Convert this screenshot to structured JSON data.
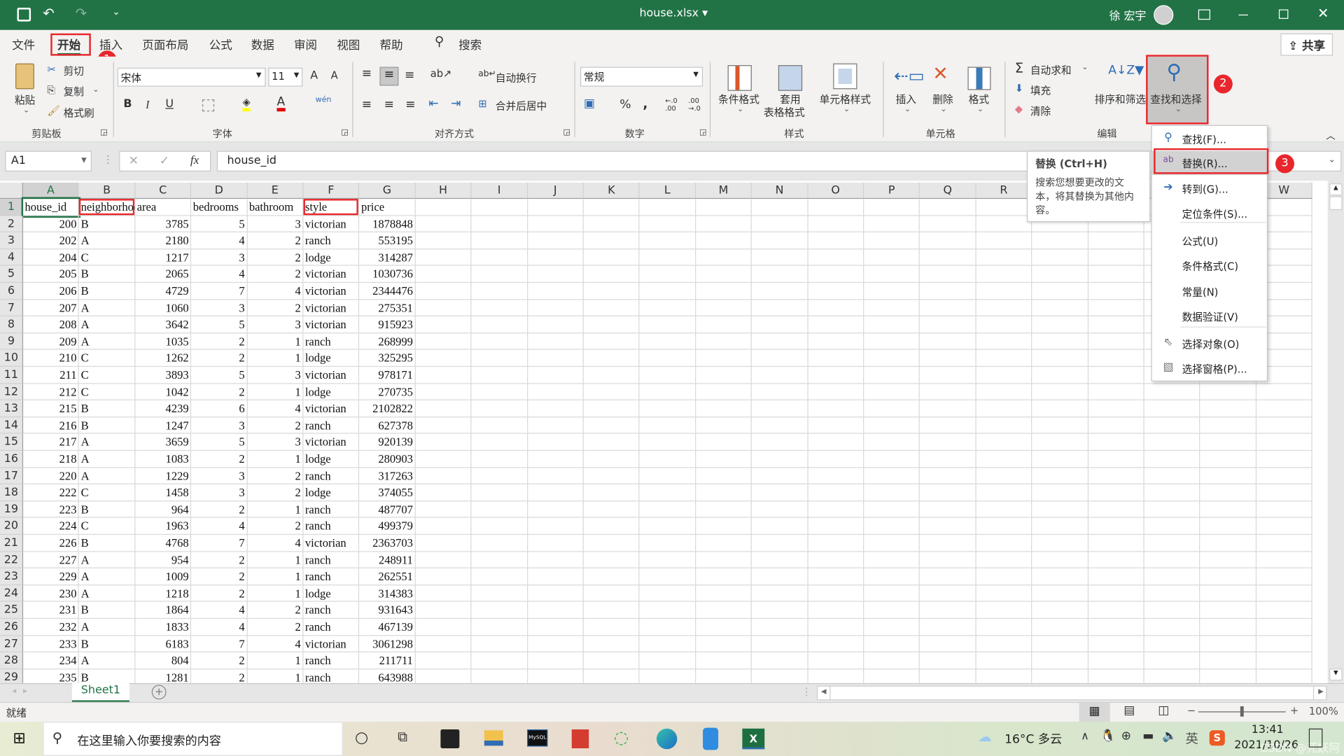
{
  "titlebar": {
    "filename": "house.xlsx",
    "dropdown": "▾",
    "user": "徐 宏宇",
    "qat_more": "⌄"
  },
  "tabs": [
    "文件",
    "开始",
    "插入",
    "页面布局",
    "公式",
    "数据",
    "审阅",
    "视图",
    "帮助"
  ],
  "active_tab": "开始",
  "search_label": "搜索",
  "share_label": "共享",
  "ribbon": {
    "clipboard": {
      "label": "剪贴板",
      "paste": "粘贴",
      "cut": "剪切",
      "copy": "复制",
      "format_painter": "格式刷"
    },
    "font": {
      "label": "字体",
      "name": "宋体",
      "size": "11",
      "bold": "B",
      "italic": "I",
      "underline": "U",
      "font_color": "A",
      "phonetic": "wén",
      "grow": "A",
      "shrink": "A"
    },
    "alignment": {
      "label": "对齐方式",
      "wrap": "自动换行",
      "merge": "合并后居中"
    },
    "number": {
      "label": "数字",
      "format": "常规",
      "percent": "%",
      "comma": ","
    },
    "styles": {
      "label": "样式",
      "conditional": "条件格式",
      "table_line1": "套用",
      "table_line2": "表格格式",
      "cell_styles": "单元格样式"
    },
    "cells": {
      "label": "单元格",
      "insert": "插入",
      "delete": "删除",
      "format": "格式"
    },
    "editing": {
      "label": "编辑",
      "autosum": "自动求和",
      "fill": "填充",
      "clear": "清除",
      "sort_filter": "排序和筛选",
      "find_select": "查找和选择"
    }
  },
  "formula_bar": {
    "name_box": "A1",
    "fx": "fx",
    "value": "house_id"
  },
  "grid": {
    "columns": [
      "A",
      "B",
      "C",
      "D",
      "E",
      "F",
      "G",
      "H",
      "I",
      "J",
      "K",
      "L",
      "M",
      "N",
      "O",
      "P",
      "Q",
      "R",
      "S",
      "T",
      "U",
      "V",
      "W"
    ],
    "header": [
      "house_id",
      "neighborhood",
      "area",
      "bedrooms",
      "bathroom",
      "style",
      "price"
    ],
    "rows": [
      [
        200,
        "B",
        3785,
        5,
        3,
        "victorian",
        1878848
      ],
      [
        202,
        "A",
        2180,
        4,
        2,
        "ranch",
        553195
      ],
      [
        204,
        "C",
        1217,
        3,
        2,
        "lodge",
        314287
      ],
      [
        205,
        "B",
        2065,
        4,
        2,
        "victorian",
        1030736
      ],
      [
        206,
        "B",
        4729,
        7,
        4,
        "victorian",
        2344476
      ],
      [
        207,
        "A",
        1060,
        3,
        2,
        "victorian",
        275351
      ],
      [
        208,
        "A",
        3642,
        5,
        3,
        "victorian",
        915923
      ],
      [
        209,
        "A",
        1035,
        2,
        1,
        "ranch",
        268999
      ],
      [
        210,
        "C",
        1262,
        2,
        1,
        "lodge",
        325295
      ],
      [
        211,
        "C",
        3893,
        5,
        3,
        "victorian",
        978171
      ],
      [
        212,
        "C",
        1042,
        2,
        1,
        "lodge",
        270735
      ],
      [
        215,
        "B",
        4239,
        6,
        4,
        "victorian",
        2102822
      ],
      [
        216,
        "B",
        1247,
        3,
        2,
        "ranch",
        627378
      ],
      [
        217,
        "A",
        3659,
        5,
        3,
        "victorian",
        920139
      ],
      [
        218,
        "A",
        1083,
        2,
        1,
        "lodge",
        280903
      ],
      [
        220,
        "A",
        1229,
        3,
        2,
        "ranch",
        317263
      ],
      [
        222,
        "C",
        1458,
        3,
        2,
        "lodge",
        374055
      ],
      [
        223,
        "B",
        964,
        2,
        1,
        "ranch",
        487707
      ],
      [
        224,
        "C",
        1963,
        4,
        2,
        "ranch",
        499379
      ],
      [
        226,
        "B",
        4768,
        7,
        4,
        "victorian",
        2363703
      ],
      [
        227,
        "A",
        954,
        2,
        1,
        "ranch",
        248911
      ],
      [
        229,
        "A",
        1009,
        2,
        1,
        "ranch",
        262551
      ],
      [
        230,
        "A",
        1218,
        2,
        1,
        "lodge",
        314383
      ],
      [
        231,
        "B",
        1864,
        4,
        2,
        "ranch",
        931643
      ],
      [
        232,
        "A",
        1833,
        4,
        2,
        "ranch",
        467139
      ],
      [
        233,
        "B",
        6183,
        7,
        4,
        "victorian",
        3061298
      ],
      [
        234,
        "A",
        804,
        2,
        1,
        "ranch",
        211711
      ],
      [
        235,
        "B",
        1281,
        2,
        1,
        "ranch",
        643988
      ]
    ]
  },
  "find_menu": {
    "items": [
      {
        "label": "查找(F)...",
        "icon": "search-icon"
      },
      {
        "label": "替换(R)...",
        "icon": "replace-icon",
        "highlighted": true
      },
      {
        "label": "转到(G)...",
        "icon": "arrow-right-icon"
      },
      {
        "label": "定位条件(S)..."
      },
      {
        "label": "公式(U)"
      },
      {
        "label": "条件格式(C)"
      },
      {
        "label": "常量(N)"
      },
      {
        "label": "数据验证(V)"
      },
      {
        "label": "选择对象(O)",
        "icon": "pointer-icon"
      },
      {
        "label": "选择窗格(P)...",
        "icon": "selection-pane-icon"
      }
    ]
  },
  "tooltip": {
    "title": "替换 (Ctrl+H)",
    "body": "搜索您想要更改的文本，将其替换为其他内容。"
  },
  "annotations": {
    "badge1": "1",
    "badge2": "2",
    "badge3": "3",
    "color": "#e8262b"
  },
  "sheet_tabs": [
    "Sheet1"
  ],
  "status": {
    "ready": "就绪",
    "zoom": "100%",
    "zoom_minus": "−",
    "zoom_plus": "+",
    "zoom_level_percent": 100
  },
  "taskbar": {
    "search_placeholder": "在这里输入你要搜索的内容",
    "weather": "16°C 多云",
    "ime": "英",
    "time": "13:41",
    "date": "2021/10/26",
    "watermark": "CSDN @死妖阿"
  },
  "colors": {
    "excel_green": "#217346",
    "ribbon_bg": "#f3f2f1",
    "highlight_red": "#e8262b"
  }
}
